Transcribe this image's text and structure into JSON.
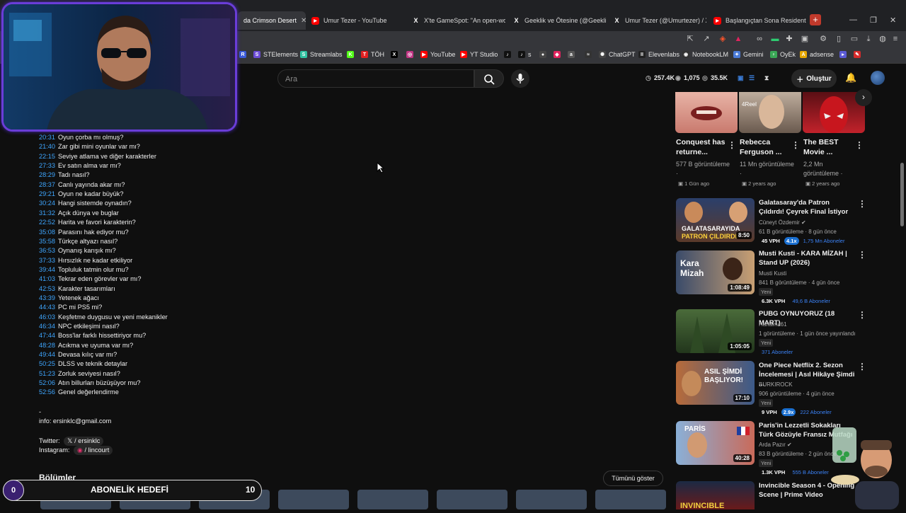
{
  "tabs": [
    {
      "title": "da Crimson Desert",
      "icon": "tab-favicon",
      "active": true
    },
    {
      "title": "Umur Tezer - YouTube",
      "icon": "youtube-icon"
    },
    {
      "title": "X'te GameSpot: \"An open-worl",
      "icon": "x-icon"
    },
    {
      "title": "Geeklik ve Ötesine (@GeeklikO",
      "icon": "x-icon"
    },
    {
      "title": "Umur Tezer (@Umurtezer) / X",
      "icon": "x-icon"
    },
    {
      "title": "Başlangıçtan Sona Resident Ev",
      "icon": "youtube-icon"
    }
  ],
  "bookmarks": [
    {
      "label": "",
      "color": "#3a5bd9",
      "glyph": "R"
    },
    {
      "label": "STElements",
      "color": "#6b4cd6",
      "glyph": "S"
    },
    {
      "label": "Streamlabs",
      "color": "#31c3a2",
      "glyph": "S"
    },
    {
      "label": "",
      "color": "#53fc18",
      "glyph": "K"
    },
    {
      "label": "TÖH",
      "color": "#e02020",
      "glyph": "T"
    },
    {
      "label": "",
      "color": "#000000",
      "glyph": "X"
    },
    {
      "label": "",
      "color": "#c13584",
      "glyph": "◎"
    },
    {
      "label": "YouTube",
      "color": "#ff0000",
      "glyph": "▶"
    },
    {
      "label": "YT Studio",
      "color": "#ff0000",
      "glyph": "▶"
    },
    {
      "label": "",
      "color": "#111111",
      "glyph": "♪"
    },
    {
      "label": "s",
      "color": "#111111",
      "glyph": "♪"
    },
    {
      "label": "",
      "color": "#444444",
      "glyph": "●"
    },
    {
      "label": "",
      "color": "#e0245e",
      "glyph": "◆"
    },
    {
      "label": "",
      "color": "#555555",
      "glyph": "a"
    },
    {
      "label": "",
      "color": "#333333",
      "glyph": "≈"
    },
    {
      "label": "ChatGPT",
      "color": "#444444",
      "glyph": "✺"
    },
    {
      "label": "Elevenlabs",
      "color": "#222222",
      "glyph": "II"
    },
    {
      "label": "NotebookLM",
      "color": "#333333",
      "glyph": "◉"
    },
    {
      "label": "Gemini",
      "color": "#4a7bd8",
      "glyph": "✦"
    },
    {
      "label": "OyEk",
      "color": "#3aa856",
      "glyph": "♀"
    },
    {
      "label": "adsense",
      "color": "#e6a700",
      "glyph": "A"
    },
    {
      "label": "",
      "color": "#5b5bd6",
      "glyph": "▸"
    },
    {
      "label": "",
      "color": "#d62b2b",
      "glyph": "✎"
    }
  ],
  "header": {
    "search_placeholder": "Ara",
    "stats": [
      "257.4K",
      "1,075",
      "35.5K"
    ],
    "create_label": "Oluştur"
  },
  "chapters": [
    {
      "ts": "20:31",
      "title": "Oyun çorba mı olmuş?"
    },
    {
      "ts": "21:40",
      "title": "Zar gibi mini oyunlar var mı?"
    },
    {
      "ts": "22:15",
      "title": "Seviye atlama ve diğer karakterler"
    },
    {
      "ts": "27:33",
      "title": "Ev satın alma var mı?"
    },
    {
      "ts": "28:29",
      "title": "Tadı nasıl?"
    },
    {
      "ts": "28:37",
      "title": "Canlı yayında akar mı?"
    },
    {
      "ts": "29:21",
      "title": "Oyun ne kadar büyük?"
    },
    {
      "ts": "30:24",
      "title": "Hangi sistemde oynadın?"
    },
    {
      "ts": "31:32",
      "title": "Açık dünya ve buglar"
    },
    {
      "ts": "22:52",
      "title": "Harita ve favori karakterin?"
    },
    {
      "ts": "35:08",
      "title": "Parasını hak ediyor mu?"
    },
    {
      "ts": "35:58",
      "title": "Türkçe altyazı nasıl?"
    },
    {
      "ts": "36:53",
      "title": "Oynanış karışık mı?"
    },
    {
      "ts": "37:33",
      "title": "Hırsızlık ne kadar etkiliyor"
    },
    {
      "ts": "39:44",
      "title": "Topluluk tatmin olur mu?"
    },
    {
      "ts": "41:03",
      "title": "Tekrar eden görevler var mı?"
    },
    {
      "ts": "42:53",
      "title": "Karakter tasarımları"
    },
    {
      "ts": "43:39",
      "title": "Yetenek ağacı"
    },
    {
      "ts": "44:43",
      "title": "PC mi PS5 mi?"
    },
    {
      "ts": "46:03",
      "title": "Keşfetme duygusu ve yeni mekanikler"
    },
    {
      "ts": "46:34",
      "title": "NPC etkileşimi nasıl?"
    },
    {
      "ts": "47:44",
      "title": "Boss'lar farklı hissettiriyor mu?"
    },
    {
      "ts": "48:28",
      "title": "Acıkma ve uyuma var mı?"
    },
    {
      "ts": "49:44",
      "title": "Devasa kılıç var mı?"
    },
    {
      "ts": "50:25",
      "title": "DLSS ve teknik detaylar"
    },
    {
      "ts": "51:23",
      "title": "Zorluk seviyesi nasıl?"
    },
    {
      "ts": "52:06",
      "title": "Atın billurları büzüşüyor mu?"
    },
    {
      "ts": "52:56",
      "title": "Genel değerlendirme"
    }
  ],
  "description": {
    "dash": "-",
    "info": "info: ersinklc@gmail.com",
    "twitter_label": "Twitter:",
    "twitter_handle": "/ ersinklc",
    "instagram_label": "Instagram:",
    "instagram_handle": "/ lincourt",
    "chapters_heading": "Bölümler",
    "show_all": "Tümünü göster"
  },
  "shorts": [
    {
      "title": "Conquest has returne...",
      "views": "577 B görüntüleme ·",
      "ago": "1 Gün ago"
    },
    {
      "title": "Rebecca Ferguson ...",
      "views": "11 Mn görüntüleme ·",
      "ago": "2 years ago"
    },
    {
      "title": "The BEST Movie ...",
      "views": "2,2 Mn görüntüleme ·",
      "ago": "2 years ago"
    }
  ],
  "videos": [
    {
      "title": "Galatasaray'da Patron Çıldırdı! Çeyrek Final İstiyor",
      "channel": "Cüneyt Özdemir",
      "meta": "61 B görüntüleme · 8 gün önce",
      "duration": "8:50",
      "vph": "45 VPH",
      "mult": "4.1x",
      "subs": "1,75 Mn Aboneler",
      "thumb_text": "GALATASARAYIDA PATRON ÇILDIRDI"
    },
    {
      "title": "Musti Kusti - KARA MİZAH | Stand UP (2026)",
      "channel": "Musti Kusti",
      "meta": "841 B görüntüleme · 4 gün önce",
      "badge": "Yeni",
      "duration": "1:08:49",
      "vph": "6.3K VPH",
      "subs": "49,6 B Aboneler",
      "thumb_text": "Kara Mizah"
    },
    {
      "title": "PUBG OYNUYORUZ (18 MART)",
      "channel": "Hartama61",
      "meta": "1 görüntüleme · 1 gün önce yayınlandı",
      "badge": "Yeni",
      "duration": "1:05:05",
      "subs": "371 Aboneler"
    },
    {
      "title": "One Piece Netflix 2. Sezon İncelemesi | Asıl Hikâye Şimdi ...",
      "channel": "BURKIROCK",
      "meta": "906 görüntüleme · 4 gün önce",
      "badge": "Yeni",
      "duration": "17:10",
      "vph": "9 VPH",
      "mult": "2.9x",
      "subs": "222 Aboneler",
      "thumb_text": "ASIL ŞİMDİ BAŞLIYOR!"
    },
    {
      "title": "Paris'in Lezzetli Sokakları Türk Gözüyle Fransız Mutfağı",
      "channel": "Arda Pazır",
      "meta": "83 B görüntüleme · 2 gün önce",
      "badge": "Yeni",
      "duration": "40:28",
      "vph": "1.3K VPH",
      "subs": "555 B Aboneler",
      "thumb_text": "PARİS"
    },
    {
      "title": "Invincible Season 4 - Opening Scene | Prime Video",
      "thumb_text": "INVINCIBLE"
    }
  ],
  "goal": {
    "current": "0",
    "label": "ABONELİK HEDEFİ",
    "target": "10",
    "progress": 0
  },
  "colors": {
    "accent": "#3ea6ff",
    "goal_border": "#6a3dd8",
    "youtube_red": "#ff0000"
  }
}
